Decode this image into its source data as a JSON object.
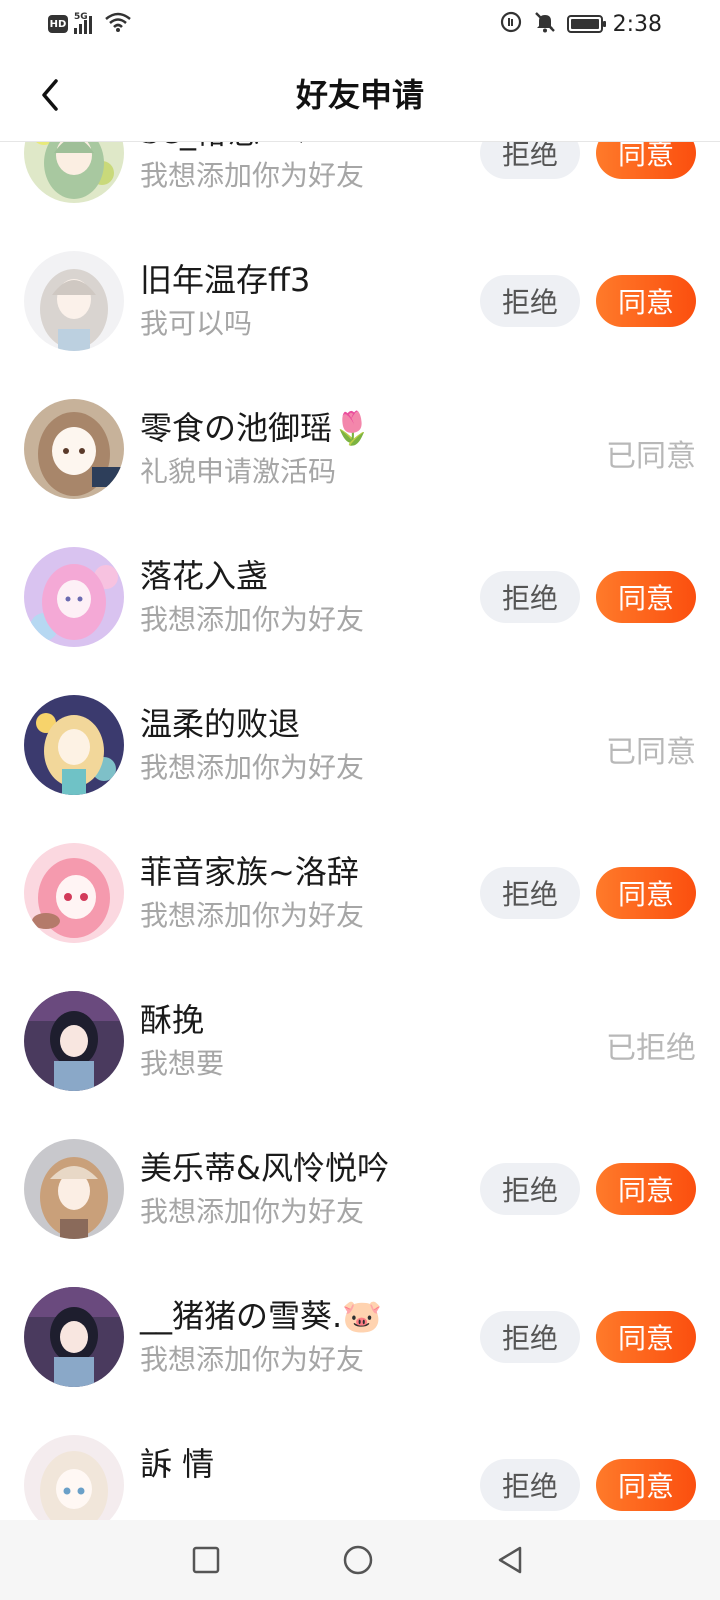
{
  "status_bar": {
    "hd": "HD",
    "network": "5G",
    "time": "2:38",
    "icons": [
      "hd-icon",
      "signal-icon",
      "wifi-icon",
      "data-saver-icon",
      "mute-icon",
      "battery-icon"
    ]
  },
  "header": {
    "title": "好友申请",
    "back_icon": "chevron-left-icon"
  },
  "buttons": {
    "reject": "拒绝",
    "accept": "同意"
  },
  "requests": [
    {
      "name": "𝕊𝕖_椿恋^♡",
      "message": "我想添加你为好友",
      "status": "pending",
      "status_text": ""
    },
    {
      "name": "旧年温存ff3",
      "message": "我可以吗",
      "status": "pending",
      "status_text": ""
    },
    {
      "name": "零食の池御瑶🌷",
      "message": "礼貌申请激活码",
      "status": "accepted",
      "status_text": "已同意"
    },
    {
      "name": "落花入盏",
      "message": "我想添加你为好友",
      "status": "pending",
      "status_text": ""
    },
    {
      "name": "温柔的败退",
      "message": "我想添加你为好友",
      "status": "accepted",
      "status_text": "已同意"
    },
    {
      "name": "菲音家族~洛辞",
      "message": "我想添加你为好友",
      "status": "pending",
      "status_text": ""
    },
    {
      "name": "酥挽",
      "message": "我想要",
      "status": "rejected",
      "status_text": "已拒绝"
    },
    {
      "name": "美乐蒂&风怜悦吟",
      "message": "我想添加你为好友",
      "status": "pending",
      "status_text": ""
    },
    {
      "name": "__猪猪の雪葵.🐷",
      "message": "我想添加你为好友",
      "status": "pending",
      "status_text": ""
    },
    {
      "name": "訴 情",
      "message": "",
      "status": "pending",
      "status_text": ""
    }
  ],
  "colors": {
    "accent": "#fb5a16",
    "reject_bg": "#eef0f4",
    "muted_text": "#a6a6a6"
  },
  "navbar": {
    "icons": [
      "recent-apps-icon",
      "home-icon",
      "back-icon"
    ]
  }
}
